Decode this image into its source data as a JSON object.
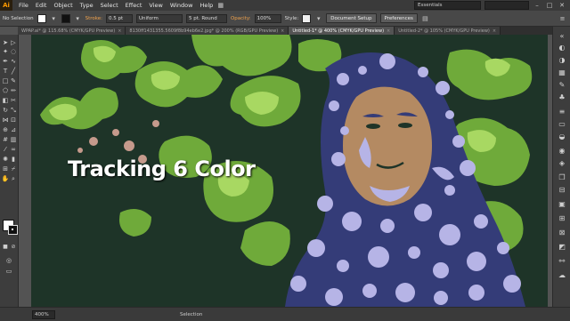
{
  "app": {
    "logo": "Ai"
  },
  "menu": {
    "items": [
      "File",
      "Edit",
      "Object",
      "Type",
      "Select",
      "Effect",
      "View",
      "Window",
      "Help"
    ],
    "workspace": "Essentials"
  },
  "controlbar": {
    "selection_label": "No Selection",
    "stroke_label": "Stroke:",
    "stroke_value": "0.5 pt",
    "stroke_profile": "Uniform",
    "brush": "5 pt. Round",
    "opacity_label": "Opacity:",
    "opacity_value": "100%",
    "style_label": "Style:",
    "document_setup": "Document Setup",
    "preferences": "Preferences"
  },
  "tabs": [
    {
      "label": "WPAP.ai* @ 115.68% (CMYK/GPU Preview)",
      "active": false
    },
    {
      "label": "8130ff1431355.5609f8b94eb6e2.jpg* @ 200% (RGB/GPU Preview)",
      "active": false
    },
    {
      "label": "Untitled-1* @ 400% (CMYK/GPU Preview)",
      "active": true
    },
    {
      "label": "Untitled-2* @ 105% (CMYK/GPU Preview)",
      "active": false
    }
  ],
  "canvas": {
    "overlay_title": "Tracking 6 Color"
  },
  "status": {
    "zoom": "400%",
    "tool": "Selection"
  },
  "colors": {
    "bg_dark_green": "#1e3428",
    "leaf_green": "#6faa3a",
    "leaf_light": "#9ed25a",
    "skin": "#b48a62",
    "scarf_navy": "#343c78",
    "scarf_lavender": "#b6b4e6"
  },
  "icons": {
    "toolbar": [
      "selection-tool",
      "direct-selection-tool",
      "magic-wand-tool",
      "lasso-tool",
      "pen-tool",
      "curvature-tool",
      "type-tool",
      "line-tool",
      "rectangle-tool",
      "paintbrush-tool",
      "shaper-tool",
      "pencil-tool",
      "eraser-tool",
      "rotate-tool",
      "scale-tool",
      "width-tool",
      "free-transform-tool",
      "shape-builder-tool",
      "perspective-grid-tool",
      "mesh-tool",
      "gradient-tool",
      "eyedropper-tool",
      "blend-tool",
      "symbol-sprayer-tool",
      "column-graph-tool",
      "artboard-tool",
      "slice-tool",
      "hand-tool",
      "zoom-tool"
    ],
    "rightpanel": [
      "color-panel-icon",
      "color-guide-icon",
      "swatches-icon",
      "brushes-icon",
      "symbols-icon",
      "stroke-icon",
      "gradient-icon",
      "transparency-icon",
      "appearance-icon",
      "graphic-styles-icon",
      "layers-icon",
      "artboards-icon",
      "image-trace-icon",
      "align-icon",
      "transform-icon",
      "pathfinder-icon",
      "links-icon",
      "libraries-icon"
    ]
  }
}
